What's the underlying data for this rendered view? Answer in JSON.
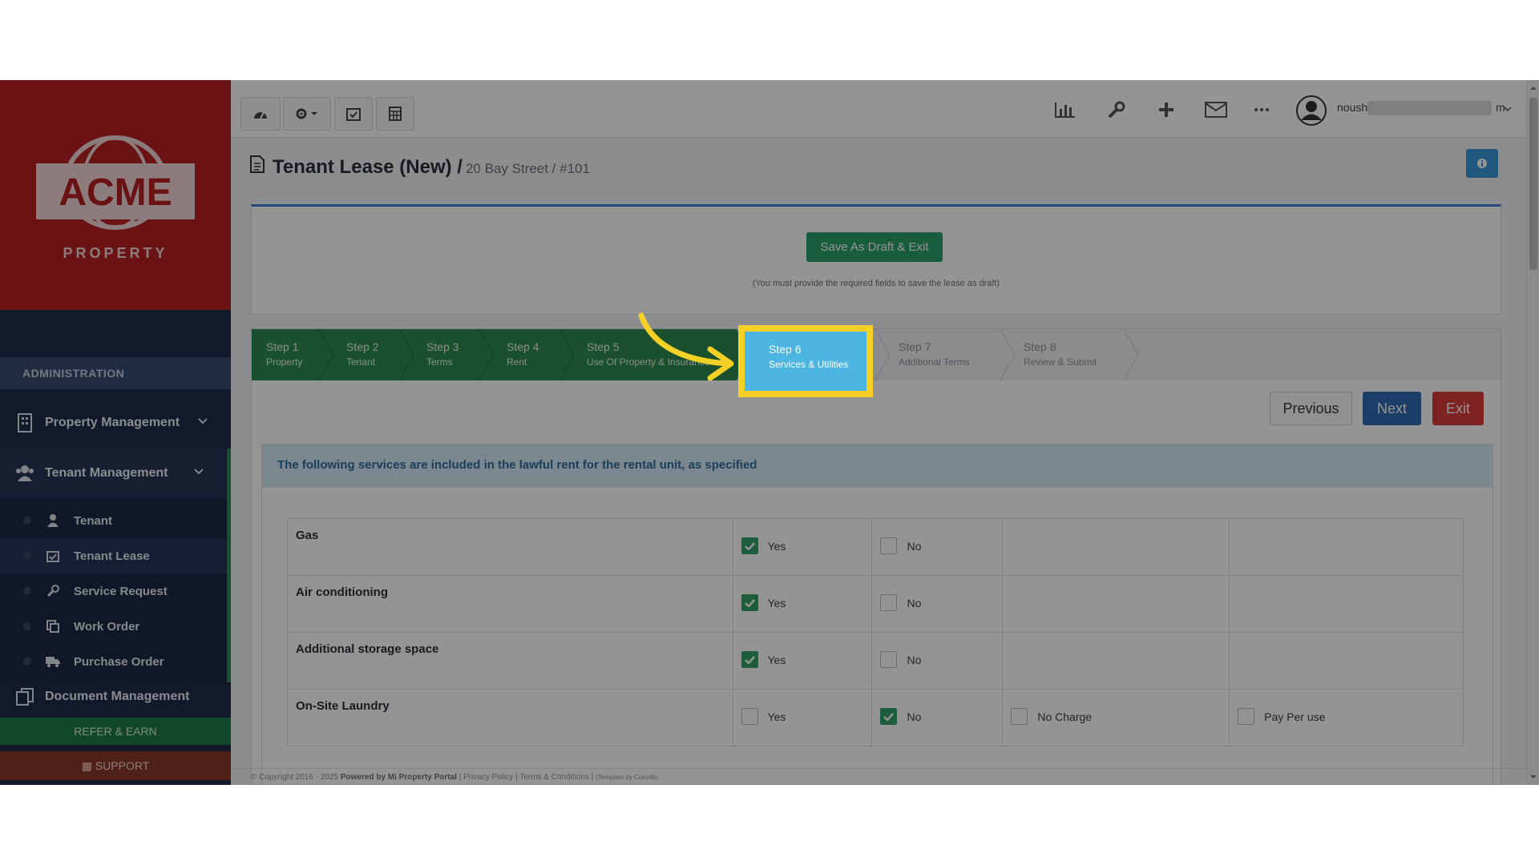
{
  "logo": {
    "brand": "ACME",
    "sub": "PROPERTY"
  },
  "sidebar": {
    "section_label": "ADMINISTRATION",
    "items": [
      {
        "label": "Property Management",
        "icon": "building-icon"
      },
      {
        "label": "Tenant Management",
        "icon": "users-icon"
      },
      {
        "label": "Document Management",
        "icon": "documents-icon"
      }
    ],
    "tenant_sub_items": [
      {
        "label": "Tenant",
        "icon": "user-icon"
      },
      {
        "label": "Tenant Lease",
        "icon": "calendar-check-icon"
      },
      {
        "label": "Service Request",
        "icon": "wrench-icon"
      },
      {
        "label": "Work Order",
        "icon": "copy-icon"
      },
      {
        "label": "Purchase Order",
        "icon": "truck-icon"
      }
    ],
    "refer_label": "REFER & EARN",
    "support_label": "SUPPORT"
  },
  "topbar": {
    "user_name": "noush",
    "user_suffix": "m"
  },
  "page": {
    "title": "Tenant Lease (New) /",
    "subtitle": "20 Bay Street / #101"
  },
  "draft": {
    "button_label": "Save As Draft & Exit",
    "note": "(You must provide the required fields to save the lease as draft)"
  },
  "steps": [
    {
      "num": "Step 1",
      "label": "Property",
      "status": "done"
    },
    {
      "num": "Step 2",
      "label": "Tenant",
      "status": "done"
    },
    {
      "num": "Step 3",
      "label": "Terms",
      "status": "done"
    },
    {
      "num": "Step 4",
      "label": "Rent",
      "status": "done"
    },
    {
      "num": "Step 5",
      "label": "Use Of Property & Insurance",
      "status": "done"
    },
    {
      "num": "Step 6",
      "label": "Services & Utilities",
      "status": "current"
    },
    {
      "num": "Step 7",
      "label": "Additional Terms",
      "status": "todo"
    },
    {
      "num": "Step 8",
      "label": "Review & Submit",
      "status": "todo"
    }
  ],
  "nav": {
    "previous": "Previous",
    "next": "Next",
    "exit": "Exit"
  },
  "services": {
    "heading": "The following services are included in the lawful rent for the rental unit, as specified",
    "rows": [
      {
        "name": "Gas",
        "yes": true,
        "no": false
      },
      {
        "name": "Air conditioning",
        "yes": true,
        "no": false
      },
      {
        "name": "Additional storage space",
        "yes": true,
        "no": false
      },
      {
        "name": "On-Site Laundry",
        "yes": false,
        "no": true,
        "extra1": "No Charge",
        "extra2": "Pay Per use"
      }
    ],
    "yes_label": "Yes",
    "no_label": "No"
  },
  "footer": {
    "copyright": "© Copyright 2016 - 2025",
    "powered": "Powered by Mi Property Portal",
    "privacy": "Privacy Policy",
    "terms": "Terms & Conditions",
    "theme": "(Template by Colorlib)"
  },
  "colors": {
    "sidebar": "#1f2c49",
    "logo_bg": "#b81f25",
    "step_done": "#2e8b4f",
    "step_current": "#4cb5e2",
    "highlight": "#f5d026",
    "next": "#2f6db5",
    "exit": "#d93b3b",
    "draft": "#2aa06b"
  }
}
